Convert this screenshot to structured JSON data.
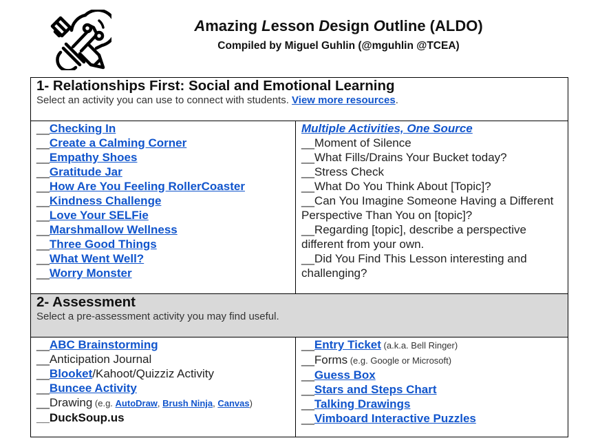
{
  "header": {
    "title_parts": [
      {
        "cap": "A",
        "rest": "mazing "
      },
      {
        "cap": "L",
        "rest": "esson "
      },
      {
        "cap": "D",
        "rest": "esign "
      },
      {
        "cap": "O",
        "rest": "utline (ALDO)"
      }
    ],
    "subtitle": "Compiled by Miguel Guhlin (@mguhlin @TCEA)",
    "logo_icon": "lightbulb-pencil-icon"
  },
  "blank": "__",
  "colors": {
    "link": "#1155cc",
    "section_grey": "#d9d9d9",
    "border": "#000000"
  },
  "sections": [
    {
      "title": "1- Relationships First: Social and Emotional Learning",
      "desc_prefix": "Select an activity you can use to connect with students. ",
      "desc_link": "View more resources",
      "desc_suffix": ".",
      "left": [
        "Checking In",
        "Create a Calming Corner",
        "Empathy Shoes",
        "Gratitude Jar",
        "How Are You Feeling RollerCoaster",
        "Kindness Challenge",
        "Love Your SELFie",
        "Marshmallow Wellness",
        "Three Good Things",
        "What Went Well?",
        "Worry Monster"
      ],
      "right_heading": "Multiple Activities, One Source",
      "right": [
        "Moment of Silence",
        "What Fills/Drains Your Bucket today?",
        "Stress Check",
        "What Do You Think About [Topic]?",
        "Can You Imagine Someone Having a Different Perspective Than You on [topic]?",
        "Regarding [topic], describe a perspective different from your own.",
        "Did You Find This Lesson interesting and challenging?"
      ]
    },
    {
      "title": "2- Assessment",
      "desc": "Select a pre-assessment activity you may find useful.",
      "left": {
        "abc": "ABC Brainstorming",
        "anticipation": "Anticipation Journal",
        "blooket_link": "Blooket",
        "blooket_rest": "/Kahoot/Quizziz Activity",
        "buncee": "Buncee Activity",
        "drawing": "Drawing",
        "drawing_note_open": " (e.g. ",
        "autodraw": "AutoDraw",
        "comma1": ", ",
        "brush_ninja": "Brush Ninja",
        "comma2": ", ",
        "canvas": "Canvas",
        "drawing_note_close": ")",
        "ducksoup": "DuckSoup.us"
      },
      "right": {
        "entry_ticket": "Entry Ticket",
        "entry_note": " (a.k.a. Bell Ringer)",
        "forms": "Forms",
        "forms_note": " (e.g. Google or Microsoft)",
        "guess_box": "Guess Box",
        "stars_steps": "Stars and Steps Chart",
        "talking_drawings": "Talking Drawings",
        "vimboard": "Vimboard Interactive Puzzles"
      }
    }
  ]
}
